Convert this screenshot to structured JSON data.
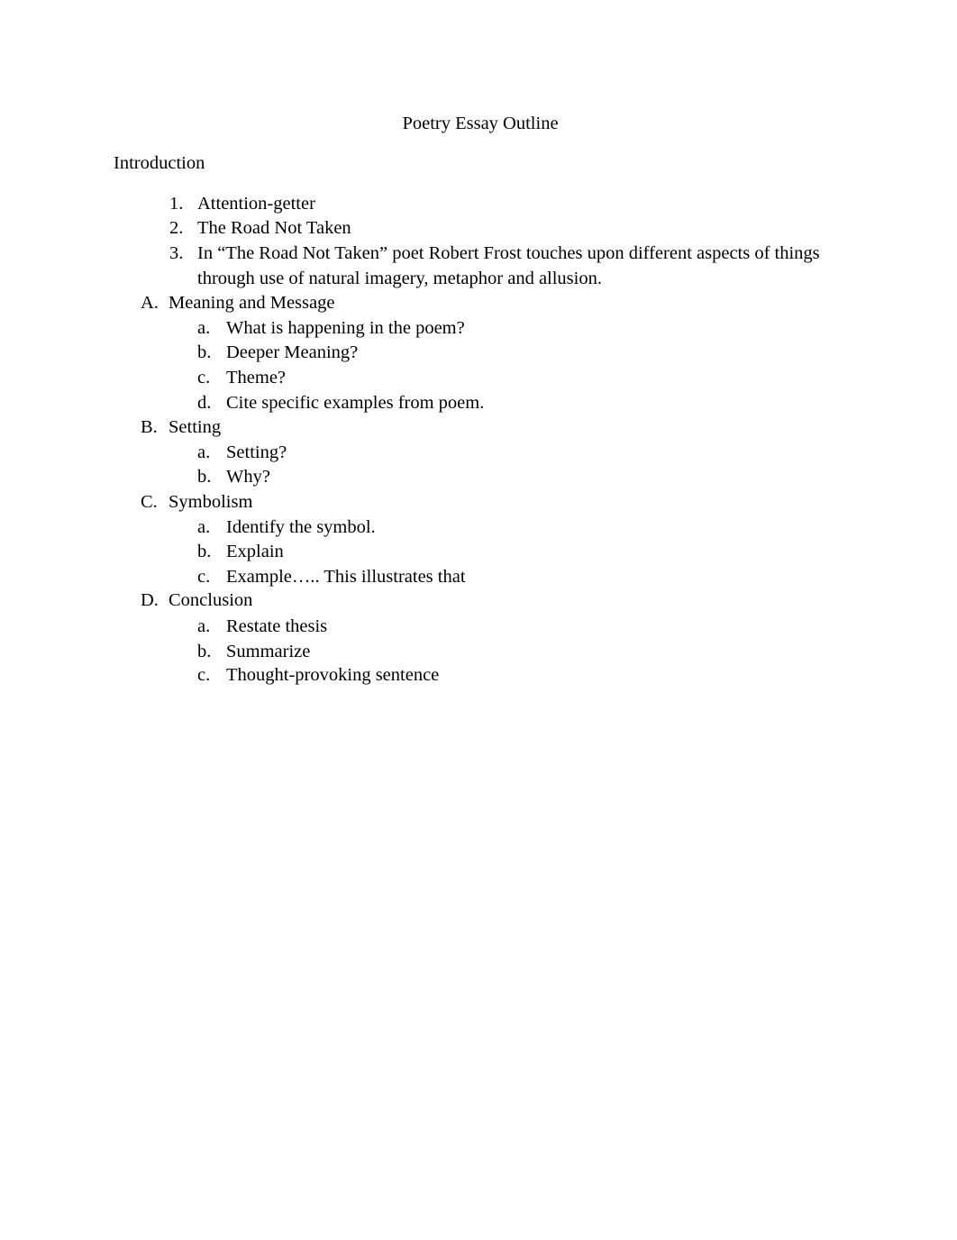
{
  "document": {
    "title": "Poetry Essay Outline",
    "introduction_heading": "Introduction",
    "intro_items": [
      {
        "marker": "1.",
        "text": "Attention-getter"
      },
      {
        "marker": "2.",
        "text": "The Road Not Taken"
      },
      {
        "marker": "3.",
        "text": "In “The Road Not Taken” poet Robert Frost touches upon different aspects of things",
        "continuation": "through use of natural imagery, metaphor and allusion."
      }
    ],
    "sections": [
      {
        "marker": "A.",
        "heading": "Meaning and Message",
        "items": [
          {
            "marker": "a.",
            "text": "What is happening in the poem?"
          },
          {
            "marker": "b.",
            "text": "Deeper Meaning?"
          },
          {
            "marker": "c.",
            "text": "Theme?"
          },
          {
            "marker": "d.",
            "text": "Cite specific examples from poem."
          }
        ]
      },
      {
        "marker": "B.",
        "heading": "Setting",
        "items": [
          {
            "marker": "a.",
            "text": "Setting?"
          },
          {
            "marker": "b.",
            "text": "Why?"
          }
        ]
      },
      {
        "marker": "C.",
        "heading": "Symbolism",
        "items": [
          {
            "marker": "a.",
            "text": "Identify the symbol."
          },
          {
            "marker": "b.",
            "text": "Explain"
          },
          {
            "marker": "c.",
            "text": "Example….. This illustrates that"
          }
        ]
      },
      {
        "marker": "D.",
        "heading": "Conclusion",
        "items": [
          {
            "marker": "a.",
            "text": "Restate thesis"
          },
          {
            "marker": "b.",
            "text": "Summarize"
          },
          {
            "marker": "c.",
            "text": "Thought-provoking sentence"
          }
        ]
      }
    ]
  }
}
